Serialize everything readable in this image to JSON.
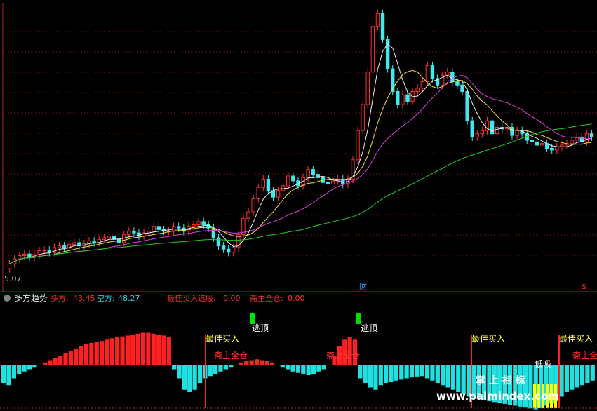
{
  "chart_data": [
    {
      "type": "candlestick",
      "low_label": "5.07",
      "marker_cai": "财",
      "marker_dollar": "$",
      "close": [
        5.3,
        5.45,
        5.55,
        5.6,
        5.5,
        5.58,
        5.7,
        5.72,
        5.65,
        5.8,
        5.85,
        5.78,
        5.9,
        5.95,
        5.85,
        5.92,
        6.0,
        5.95,
        6.05,
        6.1,
        6.15,
        6.05,
        5.95,
        6.2,
        6.3,
        6.25,
        6.15,
        6.25,
        6.3,
        6.45,
        6.35,
        6.3,
        6.3,
        6.45,
        6.4,
        6.3,
        6.45,
        6.5,
        6.6,
        6.5,
        6.4,
        6.1,
        5.85,
        5.75,
        5.65,
        5.8,
        6.2,
        6.7,
        6.9,
        7.3,
        7.65,
        7.9,
        7.55,
        7.35,
        7.55,
        7.7,
        8.0,
        7.85,
        7.7,
        7.95,
        8.2,
        8.05,
        7.95,
        7.8,
        7.75,
        7.85,
        7.9,
        7.75,
        7.9,
        8.5,
        9.4,
        10.2,
        11.2,
        12.6,
        13.0,
        12.2,
        11.3,
        10.6,
        10.2,
        10.5,
        10.3,
        10.6,
        10.7,
        10.9,
        11.4,
        11.0,
        10.8,
        11.1,
        11.2,
        10.9,
        10.8,
        10.6,
        9.7,
        9.2,
        9.3,
        9.4,
        9.7,
        9.3,
        9.5,
        9.45,
        9.5,
        9.25,
        9.4,
        9.3,
        9.1,
        9.05,
        8.95,
        9.0,
        8.85,
        8.8,
        8.9,
        8.95,
        9.0,
        9.1,
        9.2,
        9.05,
        9.3,
        9.2
      ],
      "ma_series": [
        {
          "name": "MA5",
          "color": "#f0f0f0"
        },
        {
          "name": "MA10",
          "color": "#f0e040"
        },
        {
          "name": "MA20",
          "color": "#e040e0"
        },
        {
          "name": "MA60",
          "color": "#20d020"
        }
      ]
    },
    {
      "type": "bar",
      "title": "多方趋势",
      "bull_label": "多方:",
      "bull_value": "43.45",
      "bear_label": "空方:",
      "bear_value": "48.27",
      "best_buy_label": "最佳买入选股:",
      "best_buy_value": "0.00",
      "hold_label": "斋主全仓:",
      "hold_value": "0.00",
      "annotations": {
        "escape_top": "逃顶",
        "best_buy": "最佳买入",
        "hold_full": "斋主全仓",
        "low_buy": "低吸",
        "watermark": "掌 上 指 标",
        "site": "www.palmindex.com"
      },
      "values": [
        -40,
        -45,
        -30,
        -20,
        -15,
        -10,
        -5,
        0,
        5,
        10,
        15,
        20,
        25,
        30,
        35,
        40,
        45,
        48,
        50,
        52,
        55,
        58,
        60,
        62,
        64,
        66,
        68,
        70,
        70,
        68,
        66,
        64,
        60,
        -10,
        -30,
        -55,
        -60,
        -55,
        -40,
        -30,
        -25,
        -20,
        -15,
        -10,
        -5,
        0,
        5,
        8,
        10,
        12,
        10,
        8,
        5,
        0,
        -5,
        -10,
        -15,
        -18,
        -20,
        -22,
        -20,
        -15,
        -10,
        0,
        20,
        40,
        55,
        60,
        55,
        -30,
        -40,
        -50,
        -55,
        -45,
        -40,
        -38,
        -35,
        -33,
        -30,
        -28,
        -26,
        -25,
        -30,
        -35,
        -40,
        -45,
        -50,
        -55,
        -60,
        -65,
        -70,
        -72,
        -75,
        -78,
        -80,
        -82,
        -84,
        -86,
        -88,
        -90,
        -92,
        -94,
        -96,
        -98,
        -95,
        -90,
        -85,
        -80,
        -70,
        -60,
        -55,
        -50,
        -45,
        -40,
        -35
      ],
      "colors": {
        "bull": "#ff2020",
        "bear": "#20e0e0",
        "yellow": "#ffff00",
        "green": "#00e000",
        "signal": "#ff2020"
      }
    }
  ]
}
